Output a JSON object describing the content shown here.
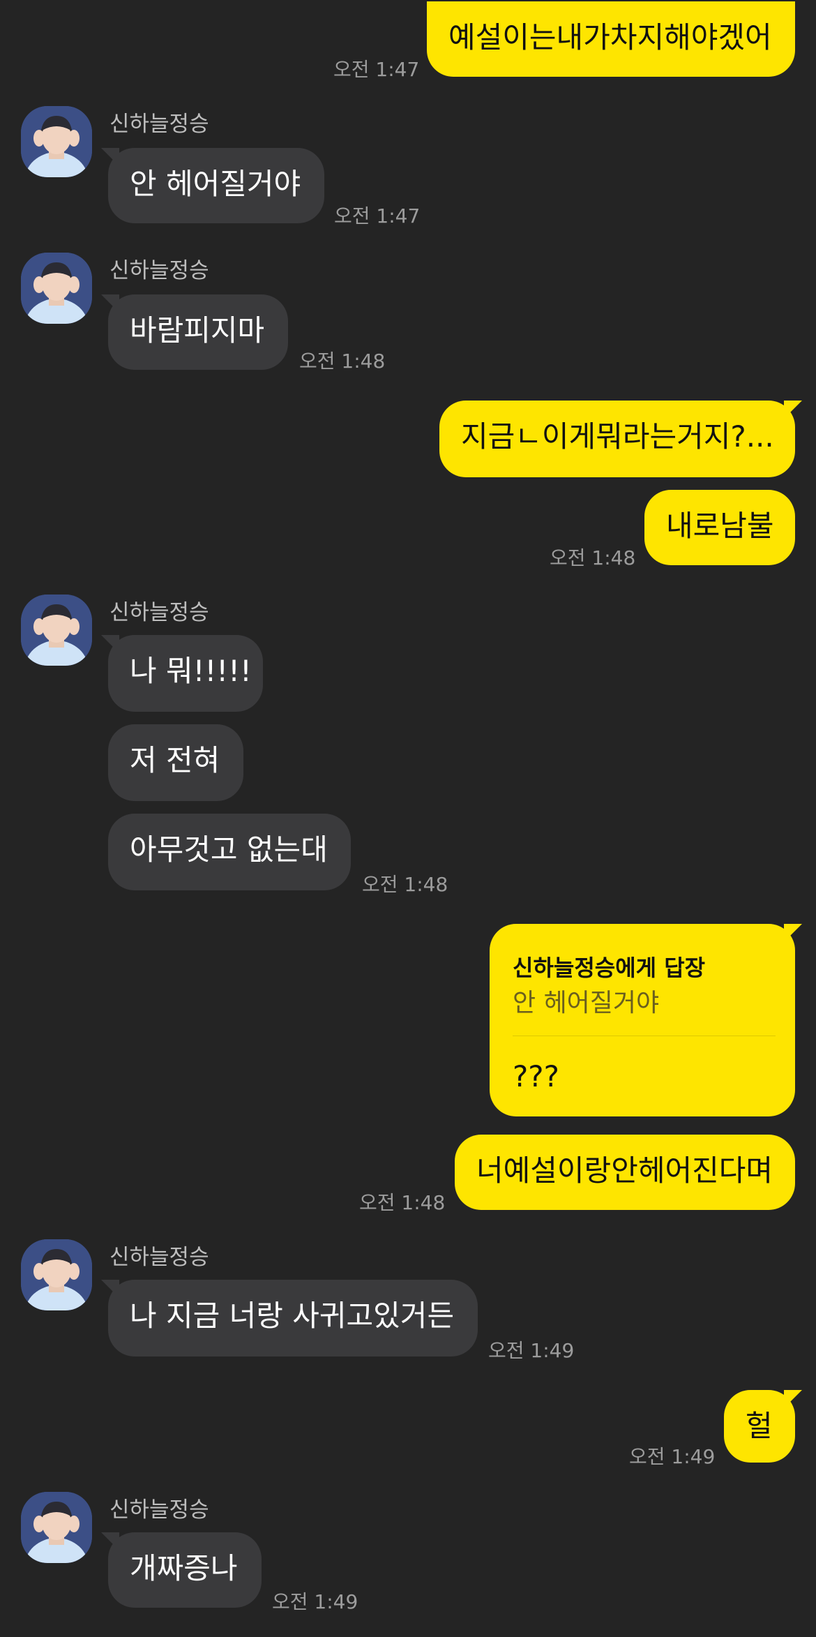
{
  "sender": {
    "name": "신하늘정승",
    "avatar_icon": "profile-photo-avatar"
  },
  "colors": {
    "background": "#242424",
    "incoming_bubble": "#3a3a3c",
    "outgoing_bubble": "#fee500",
    "timestamp": "#9c9c9c"
  },
  "messages": [
    {
      "text": "예설이는내가차지해야겠어",
      "time": "오전 1:47"
    },
    {
      "text": "안 헤어질거야",
      "time": "오전 1:47"
    },
    {
      "text": "바람피지마",
      "time": "오전 1:48"
    },
    {
      "text": "지금ㄴ이게뭐라는거지?...",
      "time": ""
    },
    {
      "text": "내로남불",
      "time": "오전 1:48"
    },
    {
      "text": "나 뭐!!!!!",
      "time": ""
    },
    {
      "text": "저 전혀",
      "time": ""
    },
    {
      "text": "아무것고 없는대",
      "time": "오전 1:48"
    },
    {
      "reply_header": "신하늘정승에게 답장",
      "reply_quote": "안 헤어질거야",
      "text": "???",
      "time": ""
    },
    {
      "text": "너예설이랑안헤어진다며",
      "time": "오전 1:48"
    },
    {
      "text": "나 지금 너랑 사귀고있거든",
      "time": "오전 1:49"
    },
    {
      "text": "헐",
      "time": "오전 1:49"
    },
    {
      "text": "개짜증나",
      "time": "오전 1:49"
    }
  ]
}
